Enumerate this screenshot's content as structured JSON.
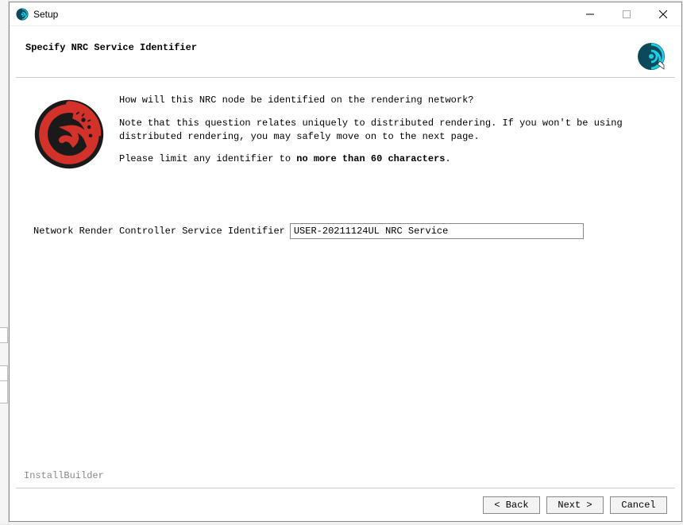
{
  "window": {
    "title": "Setup"
  },
  "header": {
    "title": "Specify NRC Service Identifier"
  },
  "intro": {
    "q": "How will this NRC node be identified on the rendering network?",
    "note": "Note that this question relates uniquely to distributed rendering.  If you won't be using distributed rendering, you may safely move on to the next page.",
    "limit_pre": "Please limit any identifier to ",
    "limit_bold": "no more than 60 characters",
    "limit_post": "."
  },
  "field": {
    "label": "Network Render Controller Service Identifier",
    "value": "USER-20211124UL NRC Service"
  },
  "footer": {
    "brand": "InstallBuilder",
    "back": "< Back",
    "next": "Next >",
    "cancel": "Cancel"
  }
}
